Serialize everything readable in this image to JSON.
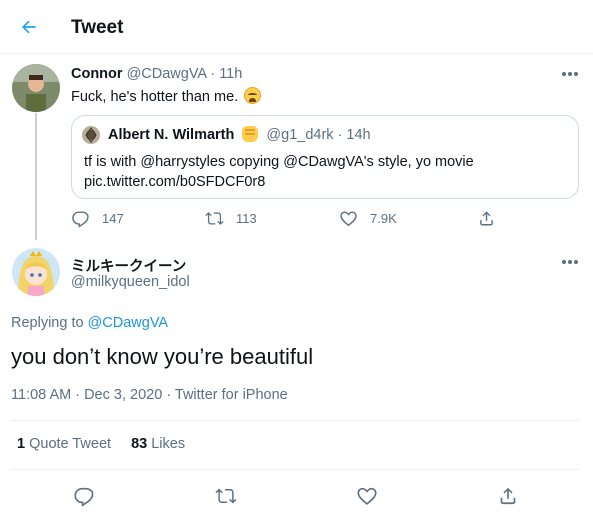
{
  "header": {
    "title": "Tweet"
  },
  "quoting_tweet": {
    "author_name": "Connor",
    "handle_time": "@CDawgVA · 11h",
    "text": "Fuck, he's hotter than me.",
    "quoted": {
      "author_name": "Albert N. Wilmarth",
      "handle_time": "@g1_d4rk · 14h",
      "text_line1": "tf is with @harrystyles copying @CDawgVA's style, yo movie",
      "text_line2": "pic.twitter.com/b0SFDCF0r8"
    },
    "replies": "147",
    "retweets": "113",
    "likes": "7.9K"
  },
  "main_tweet": {
    "author_name": "ミルキークイーン",
    "handle": "@milkyqueen_idol",
    "replying_prefix": "Replying to",
    "replying_to": "@CDawgVA",
    "text": "you don’t know you’re beautiful",
    "meta": "11:08 AM · Dec 3, 2020 · Twitter for iPhone",
    "quote_count": "1",
    "quote_label": "Quote Tweet",
    "like_count": "83",
    "like_label": "Likes"
  },
  "colors": {
    "accent": "#1b95e0",
    "muted": "#5b7083",
    "border": "#ebeef0",
    "text": "#0f1419"
  }
}
